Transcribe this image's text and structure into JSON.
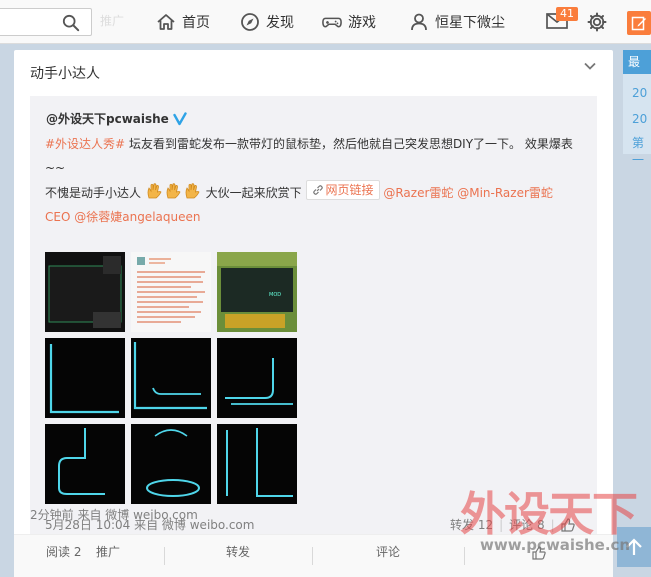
{
  "topnav": {
    "search_placeholder": "",
    "ghost_left": "推广",
    "home_label": "首页",
    "discover_label": "发现",
    "games_label": "游戏",
    "profile_label": "恒星下微尘",
    "message_count": "41",
    "accent": "#fa7d3c"
  },
  "card": {
    "title": "动手小达人",
    "repost": {
      "author": "@外设天下pcwaishe",
      "hashtag": "#外设达人秀#",
      "text1": " 坛友看到雷蛇发布一款带灯的鼠标垫，然后他就自己突发思想DIY了一下。 效果爆表~~",
      "text2": "不愧是动手小达人",
      "text3": " 大伙一起来欣赏下 ",
      "web_link": "网页链接",
      "mention1": "@Razer雷蛇",
      "mention2": "@Min-Razer雷蛇",
      "mention3": "CEO",
      "mention4": "@徐蓉婕angelaqueen",
      "date": "5月28日 10:04 来自 微博 weibo.com",
      "repost_count": "转发 12",
      "comment_count": "评论 8",
      "link_color": "#eb7350"
    },
    "post_meta": "2分钟前 来自 微博 weibo.com",
    "actions": {
      "read": "阅读 2",
      "promote": "推广",
      "repost": "转发",
      "comment": "评论"
    }
  },
  "right_rail": {
    "header": "最近",
    "items": [
      "20",
      "20",
      "第一"
    ]
  },
  "watermark": {
    "text": "外设天下",
    "url": "www.pcwaishe.cn"
  }
}
